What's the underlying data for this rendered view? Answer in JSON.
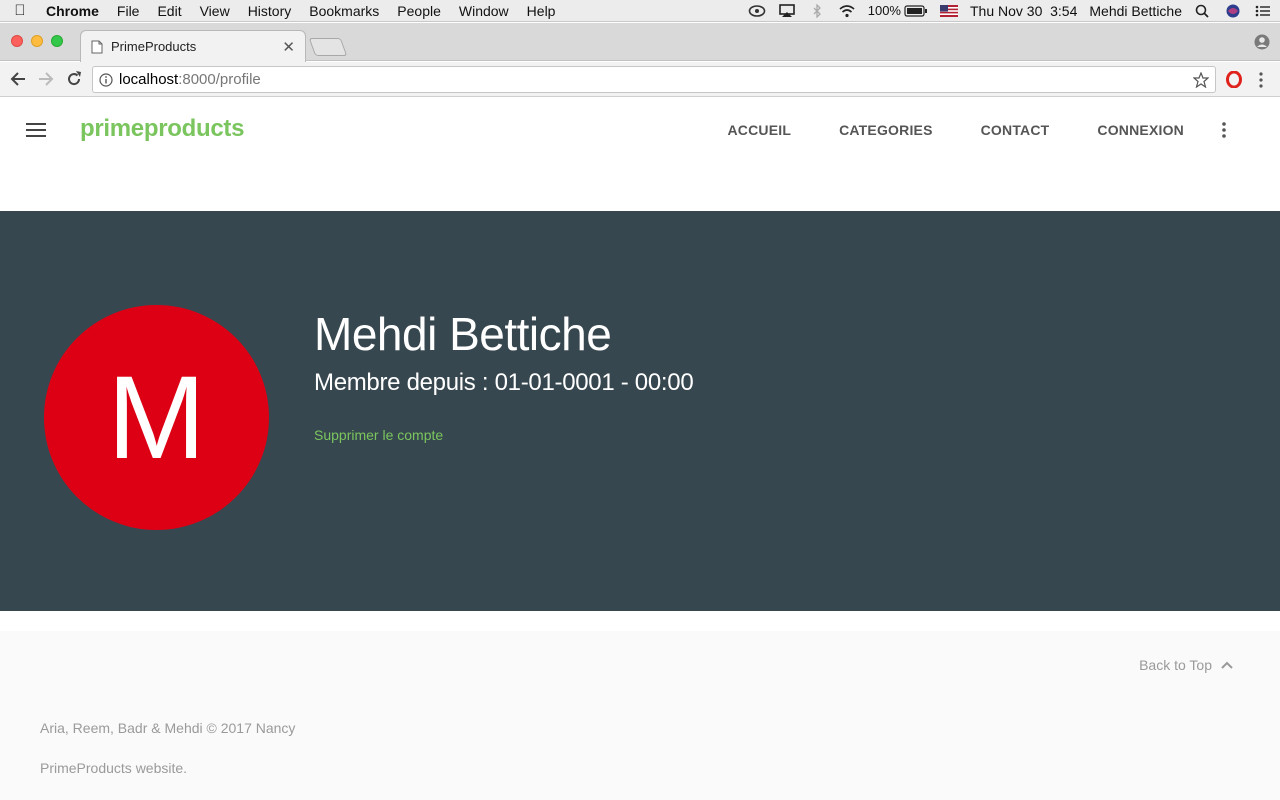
{
  "os_menubar": {
    "app_name": "Chrome",
    "items": [
      "File",
      "Edit",
      "View",
      "History",
      "Bookmarks",
      "People",
      "Window",
      "Help"
    ],
    "battery": "100%",
    "clock": "Thu Nov 30  3:54",
    "user": "Mehdi Bettiche"
  },
  "browser": {
    "tab_title": "PrimeProducts",
    "url_host": "localhost",
    "url_rest": ":8000/profile"
  },
  "site": {
    "brand": "primeproducts",
    "brand_color": "#7ac55e",
    "nav": [
      "ACCUEIL",
      "CATEGORIES",
      "CONTACT",
      "CONNEXION"
    ]
  },
  "profile": {
    "avatar_letter": "M",
    "avatar_color": "#dd0015",
    "name": "Mehdi Bettiche",
    "member_since": "Membre depuis : 01-01-0001 - 00:00",
    "delete_label": "Supprimer le compte",
    "hero_bg": "#37474f"
  },
  "footer": {
    "back_to_top": "Back to Top",
    "credits": "Aria, Reem, Badr & Mehdi © 2017 Nancy",
    "description": "PrimeProducts website."
  }
}
